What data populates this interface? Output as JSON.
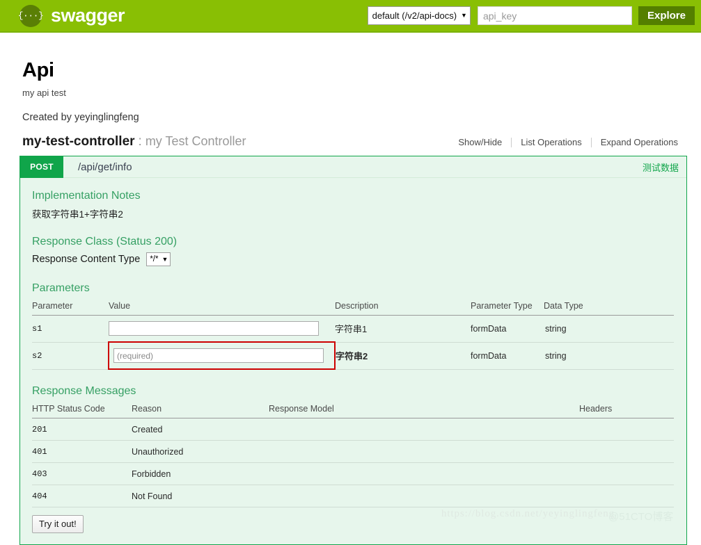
{
  "topbar": {
    "logo_glyph": "{···}",
    "brand": "swagger",
    "spec_select": {
      "value": "default (/v2/api-docs)",
      "caret": "▼"
    },
    "api_key": {
      "value": "",
      "placeholder": "api_key"
    },
    "explore_label": "Explore",
    "bg_color": "#89bf04",
    "explore_color": "#547f00"
  },
  "info": {
    "title": "Api",
    "description": "my api test",
    "created_by": "Created by yeyinglingfeng"
  },
  "resource": {
    "name": "my-test-controller",
    "separator": ":",
    "description": "my Test Controller",
    "links": [
      {
        "label": "Show/Hide"
      },
      {
        "label": "List Operations"
      },
      {
        "label": "Expand Operations"
      }
    ]
  },
  "operation": {
    "method": "POST",
    "path": "/api/get/info",
    "summary": "测试数据",
    "method_color": "#10a54a",
    "notes_heading": "Implementation Notes",
    "notes_text": "获取字符串1+字符串2",
    "response_class_heading": "Response Class (Status 200)",
    "content_type_label": "Response Content Type",
    "content_type_value": "*/*",
    "content_type_caret": "▼",
    "parameters_heading": "Parameters",
    "parameters_columns": [
      "Parameter",
      "Value",
      "Description",
      "Parameter Type",
      "Data Type"
    ],
    "parameters": [
      {
        "name": "s1",
        "value": "",
        "placeholder": "",
        "description": "字符串1",
        "parameter_type": "formData",
        "data_type": "string",
        "error": false
      },
      {
        "name": "s2",
        "value": "",
        "placeholder": "(required)",
        "description": "字符串2",
        "parameter_type": "formData",
        "data_type": "string",
        "error": true
      }
    ],
    "error_color": "#cc0000",
    "response_messages_heading": "Response Messages",
    "response_columns": [
      "HTTP Status Code",
      "Reason",
      "Response Model",
      "Headers"
    ],
    "response_messages": [
      {
        "code": "201",
        "reason": "Created",
        "model": "",
        "headers": ""
      },
      {
        "code": "401",
        "reason": "Unauthorized",
        "model": "",
        "headers": ""
      },
      {
        "code": "403",
        "reason": "Forbidden",
        "model": "",
        "headers": ""
      },
      {
        "code": "404",
        "reason": "Not Found",
        "model": "",
        "headers": ""
      }
    ],
    "try_it_out_label": "Try it out!"
  },
  "watermarks": {
    "url": "https://blog.csdn.net/yeyinglingfeng",
    "cto": "@51CTO博客"
  }
}
